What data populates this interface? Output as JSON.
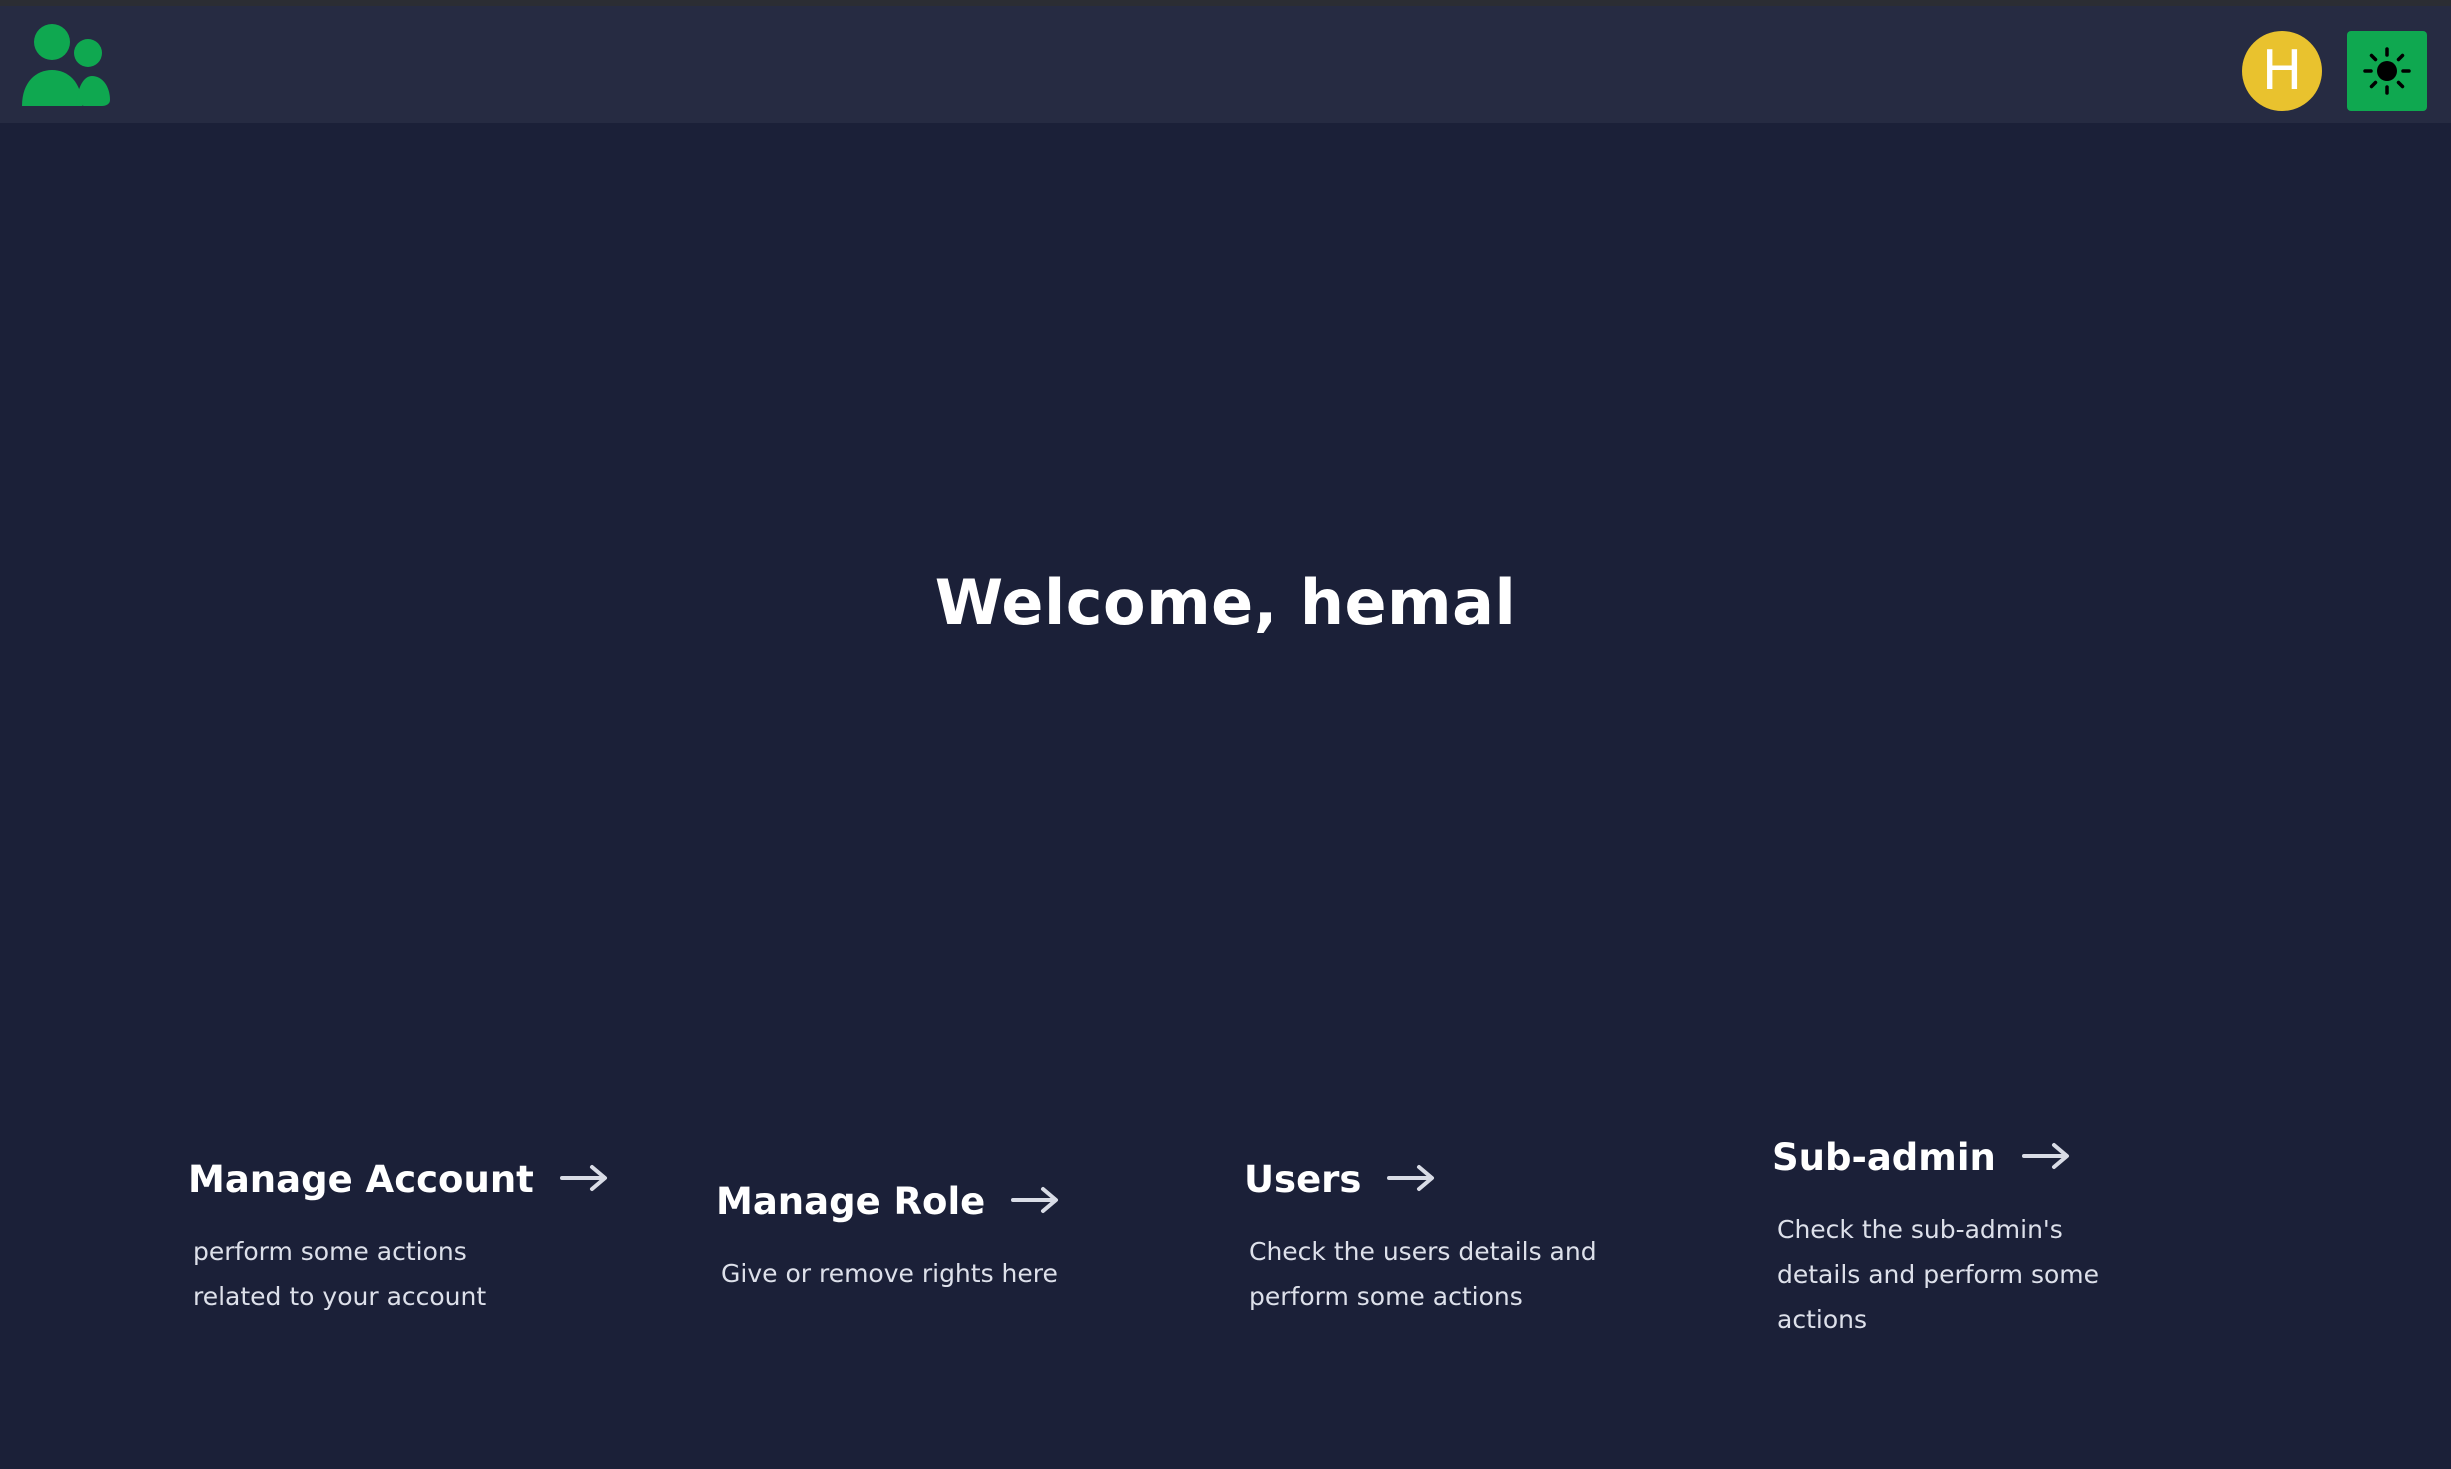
{
  "header": {
    "logo_icon": "users-group-icon",
    "avatar_initial": "H",
    "theme_icon": "sun-icon"
  },
  "main": {
    "welcome": "Welcome, hemal"
  },
  "cards": [
    {
      "title": "Manage Account",
      "description": "perform some actions related to your account"
    },
    {
      "title": "Manage Role",
      "description": "Give or remove rights here"
    },
    {
      "title": "Users",
      "description": "Check the users details and perform some actions"
    },
    {
      "title": "Sub-admin",
      "description": "Check the sub-admin's details and perform some actions"
    }
  ],
  "colors": {
    "background": "#1b2038",
    "navbar": "#262b42",
    "brand_green": "#0fa850",
    "avatar_yellow": "#e9c22e"
  }
}
